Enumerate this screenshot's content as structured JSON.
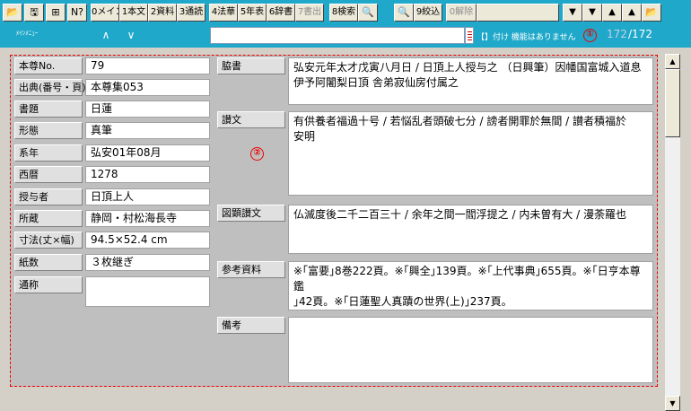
{
  "toolbar": {
    "buttons": [
      {
        "label": "📂"
      },
      {
        "label": "🖫"
      },
      {
        "label": "⊞"
      },
      {
        "label": "N?"
      },
      {
        "label": "0メイン"
      },
      {
        "label": "1本文"
      },
      {
        "label": "2資料"
      },
      {
        "label": "3通読"
      },
      {
        "label": "4法華"
      },
      {
        "label": "5年表"
      },
      {
        "label": "6辞書"
      },
      {
        "label": "7書出"
      },
      {
        "label": "8検索"
      },
      {
        "label": "🔍"
      },
      {
        "label": "🔍"
      },
      {
        "label": "9絞込"
      },
      {
        "label": "0解除"
      },
      {
        "label": "▼"
      },
      {
        "label": "▼"
      },
      {
        "label": "▲"
      },
      {
        "label": "▲"
      },
      {
        "label": "📂"
      }
    ]
  },
  "nav": {
    "main_menu_label": "ﾒｲﾝﾒﾆｭｰ",
    "prev_label": "∧",
    "next_label": "∨",
    "search_value": "",
    "status_text": "【】付け 機能はありません",
    "badge1": "①",
    "record_current": "172",
    "record_total": "/172"
  },
  "fields": [
    {
      "label": "本尊No.",
      "value": "79"
    },
    {
      "label": "出典(番号・頁)",
      "value": "本尊集053"
    },
    {
      "label": "書題",
      "value": "日蓮"
    },
    {
      "label": "形態",
      "value": "真筆"
    },
    {
      "label": "系年",
      "value": "弘安01年08月"
    },
    {
      "label": "西暦",
      "value": "1278"
    },
    {
      "label": "授与者",
      "value": "日頂上人"
    },
    {
      "label": "所蔵",
      "value": "静岡・村松海長寺"
    },
    {
      "label": "寸法(丈×幅)",
      "value": "94.5×52.4 cm"
    },
    {
      "label": "紙数",
      "value": "３枚継ぎ"
    },
    {
      "label": "通称",
      "value": ""
    }
  ],
  "texts": [
    {
      "label": "脇書",
      "lines": [
        "弘安元年太才戊寅八月日 / 日頂上人授与之 （日興筆）因幡国富城入道息",
        "伊予阿闍梨日頂 舎弟寂仙房付属之"
      ]
    },
    {
      "label": "讃文",
      "lines": [
        "有供養者福過十号 / 若悩乱者頭破七分 / 謗者開罪於無間 / 讃者積福於",
        "安明"
      ]
    },
    {
      "label": "図顕讃文",
      "lines": [
        "仏滅度後二千二百三十 / 余年之間一閻浮提之 / 内未曽有大 / 漫荼羅也"
      ]
    },
    {
      "label": "参考資料",
      "lines": [
        "※｢富要｣8巻222頁。※｢興全｣139頁。※｢上代事典｣655頁。※｢日亨本尊鑑",
        "｣42頁。※｢日蓮聖人真蹟の世界(上)｣237頁。"
      ]
    },
    {
      "label": "備考",
      "lines": [
        ""
      ]
    }
  ],
  "badge2": "②",
  "colors": {
    "toolbar_bg": "#1fa8c9",
    "annotation": "#e00000"
  }
}
